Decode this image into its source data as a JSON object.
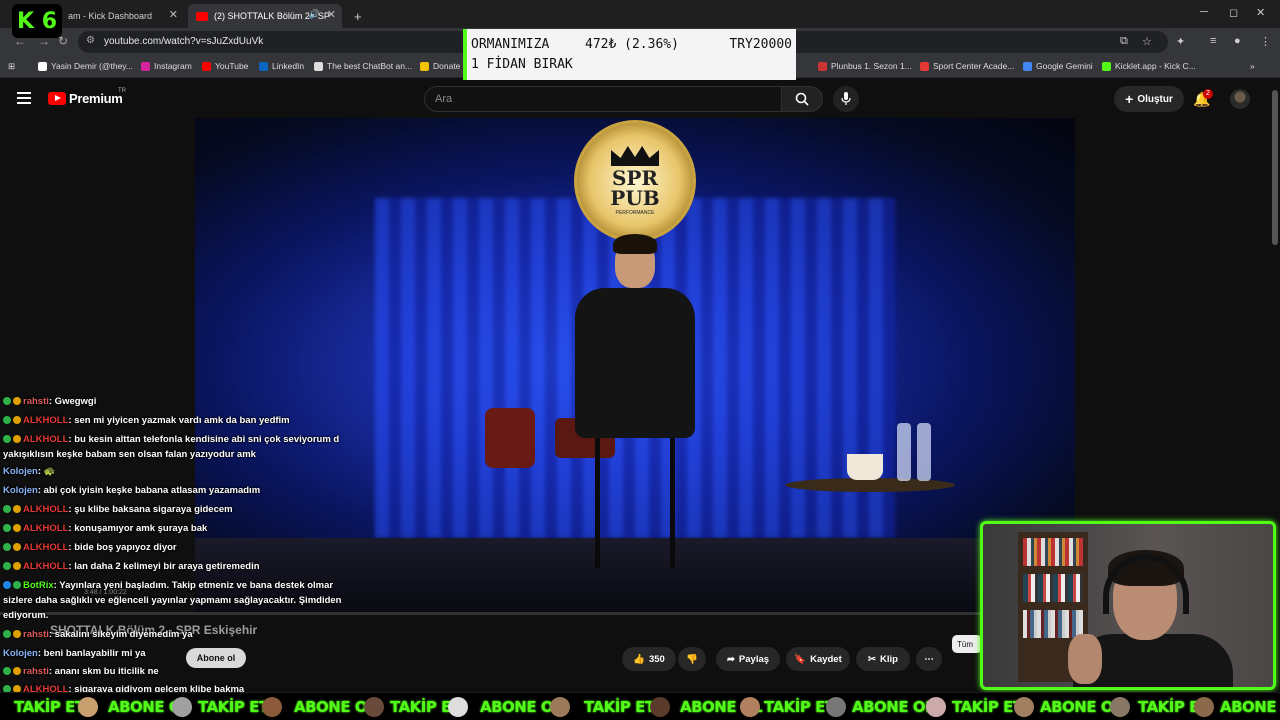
{
  "browser": {
    "tabs": [
      {
        "label": "am - Kick Dashboard"
      },
      {
        "label": "(2) SHOTTALK Bölüm 2 - SP"
      }
    ],
    "new_tab": "+",
    "url": "youtube.com/watch?v=sJuZxdUuVk",
    "bookmarks": [
      {
        "label": "Yasin Demir (@they..."
      },
      {
        "label": "Instagram"
      },
      {
        "label": "YouTube"
      },
      {
        "label": "LinkedIn"
      },
      {
        "label": "The best ChatBot an..."
      },
      {
        "label": "Donate B"
      },
      {
        "label": "Plunbus 1. Sezon 1..."
      },
      {
        "label": "Sport Center Acade..."
      },
      {
        "label": "Google Gemini"
      },
      {
        "label": "Kicklet.app - Kick C..."
      }
    ]
  },
  "kick_logo": "K 6",
  "donation": {
    "line1": "ORMANIMIZA",
    "amount": "472₺ (2.36%)",
    "goal": "TRY20000",
    "line2": "1 FİDAN BIRAK"
  },
  "youtube": {
    "brand": "Premium",
    "region": "TR",
    "search_placeholder": "Ara",
    "create_label": "Oluştur",
    "notif_count": "2",
    "video_title": "SHOTTALK Bölüm 2 - SPR Eskişehir",
    "subscribe_label": "Abone ol",
    "time": "3:48 / 1:00:22",
    "actions": {
      "likes": "350",
      "share": "Paylaş",
      "save": "Kaydet",
      "clip": "Klip",
      "more": "⋯"
    },
    "all_chip": "Tüm"
  },
  "video_scene": {
    "sign_line1": "SPR",
    "sign_line2": "PUB",
    "sign_sub": "PERFORMANCE"
  },
  "chat": [
    {
      "user": "rahsti",
      "text": ": Gwegwgi",
      "color": "#e05a5a",
      "badges": [
        "b1",
        "b2"
      ]
    },
    {
      "user": "ALKHOLL",
      "text": ": sen mi yiyicen yazmak vardı amk da ban yedfim",
      "color": "#e53935",
      "badges": [
        "b1",
        "b2"
      ]
    },
    {
      "user": "ALKHOLL",
      "text": ": bu kesin alttan telefonla kendisine abi sni çok seviyorum d",
      "color": "#e53935",
      "badges": [
        "b1",
        "b2"
      ]
    },
    {
      "user": "",
      "text": "yakışıklısın keşke babam sen olsan falan yazıyodur amk",
      "color": "#e53935",
      "badges": []
    },
    {
      "user": "Kolojen",
      "text": ": 🐢",
      "color": "#8ab4f8",
      "badges": []
    },
    {
      "user": "Kolojen",
      "text": ": abi çok iyisin keşke babana atlasam yazamadım",
      "color": "#8ab4f8",
      "badges": []
    },
    {
      "user": "ALKHOLL",
      "text": ": şu klibe baksana sigaraya gidecem",
      "color": "#e53935",
      "badges": [
        "b1",
        "b2"
      ]
    },
    {
      "user": "ALKHOLL",
      "text": ": konuşamıyor amk şuraya bak",
      "color": "#e53935",
      "badges": [
        "b1",
        "b2"
      ]
    },
    {
      "user": "ALKHOLL",
      "text": ": bide boş yapıyoz diyor",
      "color": "#e53935",
      "badges": [
        "b1",
        "b2"
      ]
    },
    {
      "user": "ALKHOLL",
      "text": ": lan daha 2 kelimeyi bir araya getiremedin",
      "color": "#e53935",
      "badges": [
        "b1",
        "b2"
      ]
    },
    {
      "user": "BotRix",
      "text": ": Yayınlara yeni başladım. Takip etmeniz ve bana destek olmar",
      "color": "#53fc18",
      "badges": [
        "b3",
        "b1"
      ]
    },
    {
      "user": "",
      "text": "sizlere daha sağlıklı ve eğlenceli yayınlar yapmamı sağlayacaktır. Şimdiden",
      "color": "#fff",
      "badges": []
    },
    {
      "user": "",
      "text": "ediyorum.",
      "color": "#fff",
      "badges": []
    },
    {
      "user": "rahsti",
      "text": ": sakalını sikeyim diyemedim ya",
      "color": "#e05a5a",
      "badges": [
        "b1",
        "b2"
      ]
    },
    {
      "user": "Kolojen",
      "text": ": beni banlayabilir mi ya",
      "color": "#8ab4f8",
      "badges": []
    },
    {
      "user": "rahsti",
      "text": ": ananı skm bu iticilik ne",
      "color": "#e05a5a",
      "badges": [
        "b1",
        "b2"
      ]
    },
    {
      "user": "ALKHOLL",
      "text": ": sigaraya gidiyom gelcem klibe bakma",
      "color": "#e53935",
      "badges": [
        "b1",
        "b2"
      ]
    }
  ],
  "ticker": {
    "follow": "TAKİP ET",
    "subscribe": "ABONE OL"
  }
}
